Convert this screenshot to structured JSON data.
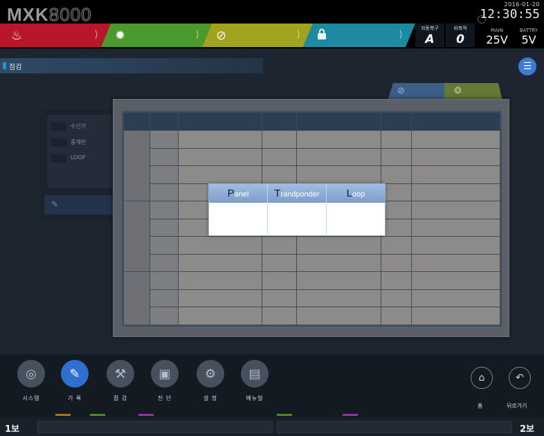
{
  "header": {
    "logo_main": "MXK",
    "logo_num": "8000",
    "date": "2016-01-20",
    "time": "12:30:55",
    "segments": {
      "fire_icon": "flame-icon",
      "fault_icon": "gear-icon",
      "disable_icon": "prohibit-icon",
      "lock_icon": "lock-icon"
    },
    "auto_recovery": {
      "label": "자동복구",
      "value": "A"
    },
    "emergency": {
      "label": "비축적",
      "value": "0"
    },
    "power_main": {
      "label": "MAIN",
      "value": "25V"
    },
    "power_battery": {
      "label": "BATTRY",
      "value": "5V"
    }
  },
  "breadcrumb": {
    "text": "점검"
  },
  "left_panel": {
    "options": [
      "수신기",
      "중계반",
      "LOOP"
    ]
  },
  "popup": {
    "columns": [
      {
        "cap": "P",
        "rest": "anel"
      },
      {
        "cap": "T",
        "rest": "randponder"
      },
      {
        "cap": "L",
        "rest": "oop"
      }
    ]
  },
  "nav": {
    "system": "시스템",
    "record": "기 록",
    "inspect": "점 검",
    "diagnose": "진 단",
    "settings": "설 정",
    "manual": "메뉴얼",
    "home": "홈",
    "back": "뒤로가기"
  },
  "footer": {
    "floor_left": "1보",
    "floor_right": "2보"
  },
  "colors": {
    "fire": "#b8172b",
    "fault": "#4a9a2d",
    "disable": "#a0a31d",
    "lock": "#1e8aa2",
    "active_nav": "#2f6fd0"
  }
}
